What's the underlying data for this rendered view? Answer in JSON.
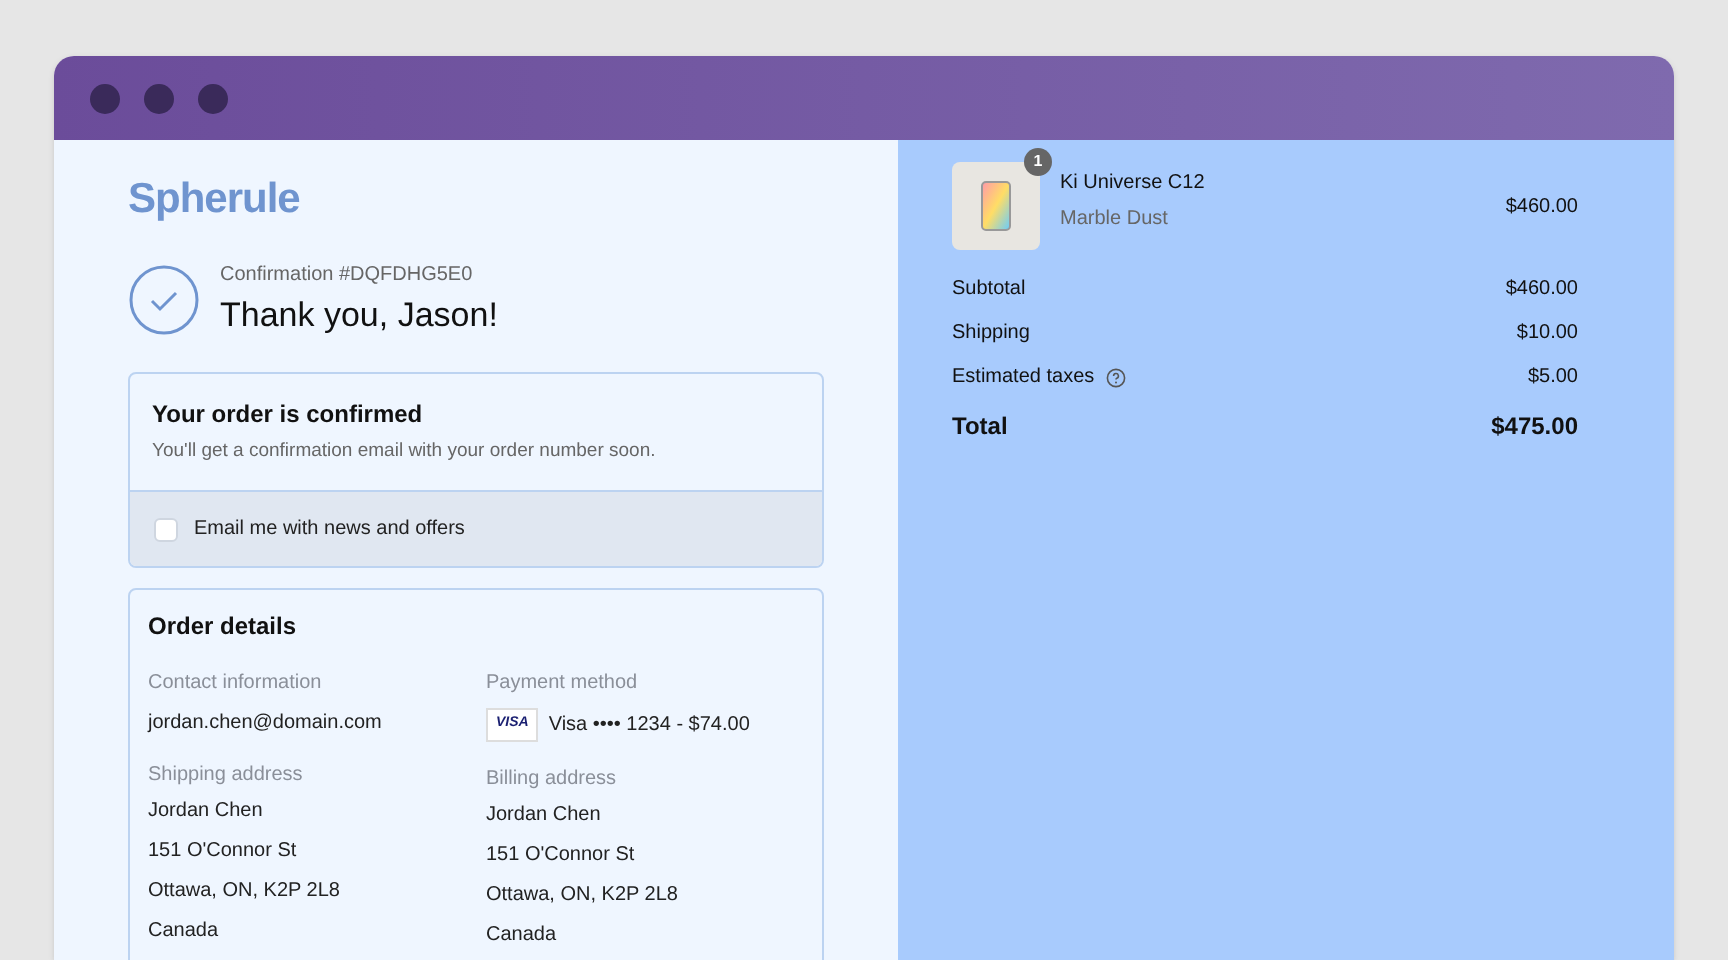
{
  "brand": "Spherule",
  "confirmation": {
    "number": "Confirmation #DQFDHG5E0",
    "greeting": "Thank you, Jason!"
  },
  "notice": {
    "title": "Your order is confirmed",
    "text": "You'll get a confirmation email with your order number soon.",
    "newsletter": {
      "label": "Email me with news and offers",
      "checked": false
    }
  },
  "details": {
    "title": "Order details",
    "contact": {
      "label": "Contact information",
      "value": "jordan.chen@domain.com"
    },
    "payment": {
      "label": "Payment method",
      "card": "VISA",
      "value": "Visa •••• 1234 - $74.00"
    },
    "shipping_address": {
      "label": "Shipping address",
      "lines": [
        "Jordan Chen",
        "151 O'Connor St",
        "Ottawa, ON, K2P 2L8",
        "Canada"
      ]
    },
    "billing_address": {
      "label": "Billing address",
      "lines": [
        "Jordan Chen",
        "151 O'Connor St",
        "Ottawa, ON, K2P 2L8",
        "Canada"
      ]
    }
  },
  "cart": {
    "items": [
      {
        "name": "Ki Universe C12",
        "variant": "Marble Dust",
        "quantity": "1",
        "price": "$460.00"
      }
    ],
    "summary": [
      {
        "label": "Subtotal",
        "value": "$460.00",
        "kind": "line"
      },
      {
        "label": "Shipping",
        "value": "$10.00",
        "kind": "line"
      },
      {
        "label": "Estimated taxes",
        "value": "$5.00",
        "kind": "info"
      },
      {
        "label": "Total",
        "value": "$475.00",
        "kind": "total"
      }
    ]
  }
}
